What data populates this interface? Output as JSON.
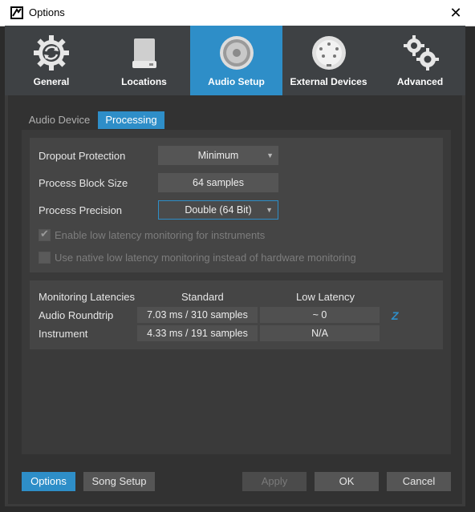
{
  "window": {
    "title": "Options",
    "close_glyph": "✕"
  },
  "categories": [
    {
      "label": "General",
      "icon": "gear-refresh-icon",
      "active": false
    },
    {
      "label": "Locations",
      "icon": "hard-drive-icon",
      "active": false
    },
    {
      "label": "Audio Setup",
      "icon": "speaker-icon",
      "active": true
    },
    {
      "label": "External Devices",
      "icon": "midi-port-icon",
      "active": false
    },
    {
      "label": "Advanced",
      "icon": "gears-icon",
      "active": false
    }
  ],
  "tabs": {
    "audio_device": "Audio Device",
    "processing": "Processing"
  },
  "settings": {
    "dropout_label": "Dropout Protection",
    "dropout_value": "Minimum",
    "block_size_label": "Process Block Size",
    "block_size_value": "64 samples",
    "precision_label": "Process Precision",
    "precision_value": "Double (64 Bit)",
    "low_latency_instruments": "Enable low latency monitoring for instruments",
    "native_low_latency": "Use native low latency monitoring instead of hardware monitoring"
  },
  "latency": {
    "header_label": "Monitoring Latencies",
    "col_standard": "Standard",
    "col_low": "Low Latency",
    "rows": [
      {
        "label": "Audio Roundtrip",
        "standard": "7.03 ms / 310 samples",
        "low": "~ 0"
      },
      {
        "label": "Instrument",
        "standard": "4.33 ms / 191 samples",
        "low": "N/A"
      }
    ],
    "z_glyph": "Z"
  },
  "footer": {
    "options": "Options",
    "song_setup": "Song Setup",
    "apply": "Apply",
    "ok": "OK",
    "cancel": "Cancel"
  },
  "colors": {
    "accent": "#2e8ec8",
    "background": "#2b2b2b",
    "panel": "#454545"
  }
}
